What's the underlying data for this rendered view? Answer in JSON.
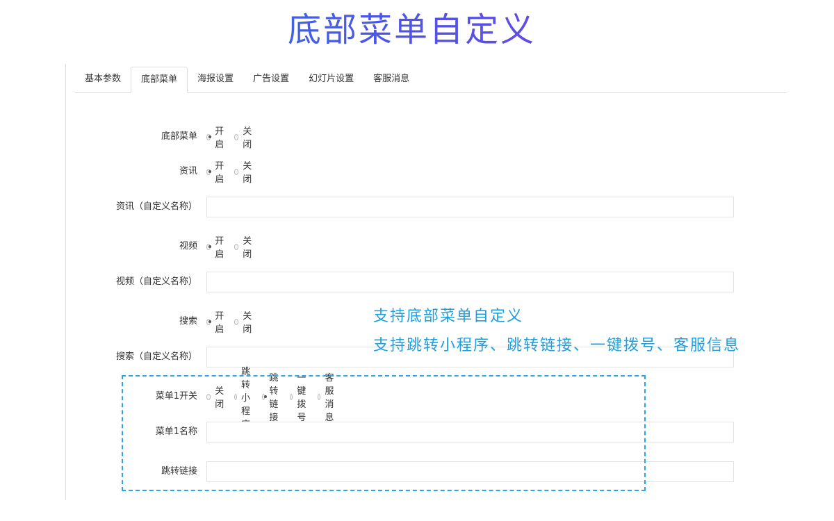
{
  "header": {
    "title": "底部菜单自定义"
  },
  "tabs": [
    {
      "label": "基本参数",
      "active": false
    },
    {
      "label": "底部菜单",
      "active": true
    },
    {
      "label": "海报设置",
      "active": false
    },
    {
      "label": "广告设置",
      "active": false
    },
    {
      "label": "幻灯片设置",
      "active": false
    },
    {
      "label": "客服消息",
      "active": false
    }
  ],
  "form": {
    "bottom_menu": {
      "label": "底部菜单",
      "options": [
        "开启",
        "关闭"
      ],
      "selected": "开启"
    },
    "news": {
      "label": "资讯",
      "options": [
        "开启",
        "关闭"
      ],
      "selected": "开启"
    },
    "news_name": {
      "label": "资讯（自定义名称）",
      "value": ""
    },
    "video": {
      "label": "视频",
      "options": [
        "开启",
        "关闭"
      ],
      "selected": "开启"
    },
    "video_name": {
      "label": "视频（自定义名称）",
      "value": ""
    },
    "search": {
      "label": "搜索",
      "options": [
        "开启",
        "关闭"
      ],
      "selected": "开启"
    },
    "search_name": {
      "label": "搜索（自定义名称）",
      "value": ""
    },
    "menu1_switch": {
      "label": "菜单1开关",
      "options": [
        "关闭",
        "跳转小程序",
        "跳转链接",
        "一键拨号",
        "客服消息"
      ],
      "selected": "跳转链接"
    },
    "menu1_name": {
      "label": "菜单1名称",
      "value": ""
    },
    "jump_link": {
      "label": "跳转链接",
      "value": ""
    }
  },
  "annotation": {
    "line1": "支持底部菜单自定义",
    "line2": "支持跳转小程序、跳转链接、一键拨号、客服信息"
  },
  "colors": {
    "accent_blue": "#1e9fe0",
    "dashed_border": "#2aa5e8"
  }
}
